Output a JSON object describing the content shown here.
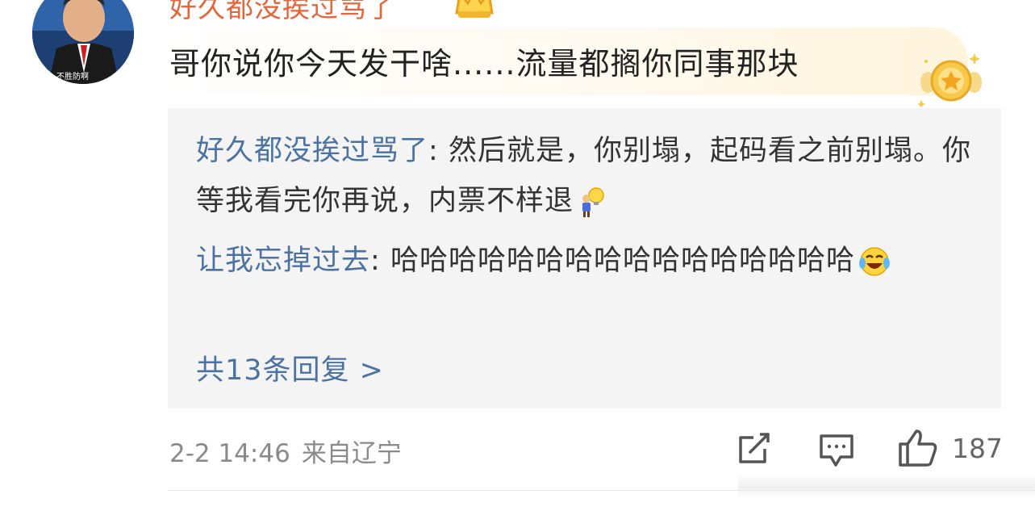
{
  "comment": {
    "username": "好久都没挨过骂了",
    "text": "哥你说你今天发干啥......流量都搁你同事那块",
    "avatar_caption": "不胜防啊",
    "badge_icon": "gold-star-badge-icon",
    "crown_icon": "crown-icon"
  },
  "replies": [
    {
      "author": "好久都没挨过骂了",
      "separator": ": ",
      "text": "然后就是，你别塌，起码看之前别塌。你等我看完你再说，内票不样退",
      "emoji": "lightbulb-figure-emoji"
    },
    {
      "author": "让我忘掉过去",
      "separator": ": ",
      "text": "哈哈哈哈哈哈哈哈哈哈哈哈哈哈哈哈",
      "emoji": "laughing-tears-emoji"
    }
  ],
  "more_replies": "共13条回复 >",
  "meta": {
    "time": "2-2 14:46",
    "location": "来自辽宁"
  },
  "actions": {
    "like_count": "187"
  },
  "colors": {
    "username": "#e3673b",
    "link_blue": "#4b72a1",
    "reply_bg": "#f4f4f4",
    "meta_gray": "#8a8a8a"
  }
}
